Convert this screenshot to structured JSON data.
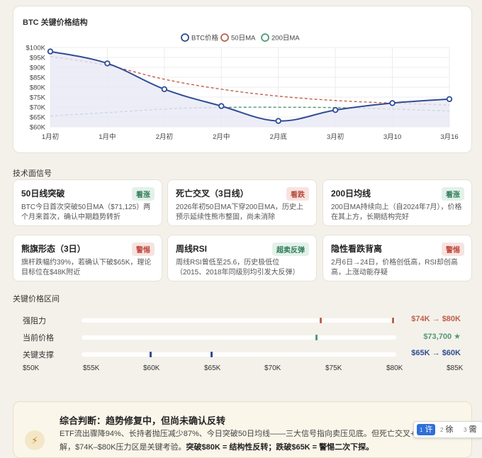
{
  "chart_data": {
    "type": "line",
    "title": "BTC 关键价格结构",
    "categories": [
      "1月初",
      "1月中",
      "2月初",
      "2月中",
      "2月底",
      "3月初",
      "3月10",
      "3月16"
    ],
    "ylim": [
      60000,
      100000
    ],
    "yticks": [
      60000,
      65000,
      70000,
      75000,
      80000,
      85000,
      90000,
      95000,
      100000
    ],
    "ytick_labels": [
      "$60K",
      "$65K",
      "$70K",
      "$75K",
      "$80K",
      "$85K",
      "$90K",
      "$95K",
      "$100K"
    ],
    "legend_position": "top-center",
    "grid": true,
    "series": [
      {
        "name": "BTC价格",
        "values": [
          98000,
          92000,
          79000,
          70500,
          63000,
          68500,
          72000,
          74000
        ],
        "color": "#2f4d93",
        "style": "solid",
        "markers": true,
        "fill": "#e8e8f6"
      },
      {
        "name": "50日MA",
        "values": [
          95500,
          91000,
          84000,
          79000,
          75500,
          73300,
          72000,
          71000
        ],
        "color": "#c0604a",
        "style": "dashed"
      },
      {
        "name": "200日MA",
        "values": [
          65500,
          67200,
          69000,
          69800,
          69900,
          69700,
          69000,
          68000
        ],
        "color": "#4f9a78",
        "style": "dashed"
      }
    ]
  },
  "signals_section_title": "技术面信号",
  "signals": [
    {
      "name": "50日线突破",
      "badge": "看涨",
      "tone": "bull",
      "desc": "BTC今日首次突破50日MA（$71,125）两个月来首次，确认中期趋势转折"
    },
    {
      "name": "死亡交叉（3日线）",
      "badge": "看跌",
      "tone": "bear",
      "desc": "2026年初50日MA下穿200日MA，历史上预示延续性熊市整固，尚未消除"
    },
    {
      "name": "200日均线",
      "badge": "看涨",
      "tone": "bull",
      "desc": "200日MA持续向上（自2024年7月），价格在其上方，长期结构完好"
    },
    {
      "name": "熊旗形态（3日）",
      "badge": "警惕",
      "tone": "warn",
      "desc": "旗杆跌幅约39%，若确认下破$65K，理论目标位在$48K附近"
    },
    {
      "name": "周线RSI",
      "badge": "超卖反弹",
      "tone": "bull",
      "desc": "周线RSI曾低至25.6，历史极低位（2015、2018年同级别均引发大反弹）"
    },
    {
      "name": "隐性看跌背离",
      "badge": "警惕",
      "tone": "warn",
      "desc": "2月6日→24日，价格创低高，RSI却创高高，上涨动能存疑"
    }
  ],
  "zones_section_title": "关键价格区间",
  "zones": [
    {
      "label": "强阻力",
      "value_text": "$74K → $80K",
      "color": "#c0604a",
      "marks": [
        74000,
        80000
      ]
    },
    {
      "label": "当前价格",
      "value_text": "$73,700 ★",
      "color": "#4f9a78",
      "marks": [
        73700
      ]
    },
    {
      "label": "关键支撑",
      "value_text": "$65K → $60K",
      "color": "#2f4d93",
      "marks": [
        65000,
        60000
      ]
    }
  ],
  "price_axis": [
    "$50K",
    "$55K",
    "$60K",
    "$65K",
    "$70K",
    "$75K",
    "$80K",
    "$85K"
  ],
  "summary": {
    "title": "综合判断：趋势修复中，但尚未确认反转",
    "line1": "ETF流出骤降94%、长持者抛压减少87%、今日突破50日均线——三大信号指向卖压见底。但死亡交叉+熊",
    "line2_a": "解，$74K–$80K压力区是关键考验。",
    "line2_b": "突破$80K = 结构性反转；跌破$65K = 警惕二次下探。"
  },
  "ime": {
    "c1": "许",
    "c2": "徐",
    "c3": "需"
  }
}
